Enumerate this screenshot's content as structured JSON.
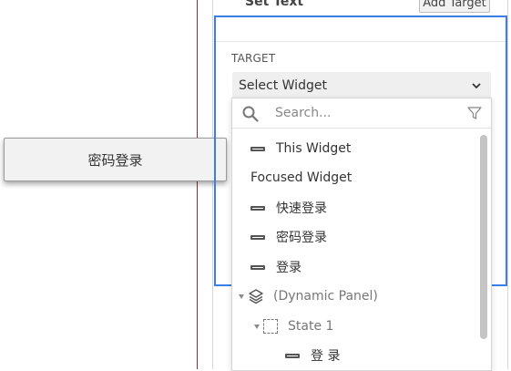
{
  "canvas": {
    "button_label": "密码登录"
  },
  "panel": {
    "set_text_label": "Set Text",
    "add_target_label": "Add Target",
    "target_label": "TARGET",
    "target_select_value": "Select Widget"
  },
  "dropdown": {
    "search_placeholder": "Search...",
    "items": [
      {
        "label": "This Widget",
        "icon": "widget-rect-icon"
      },
      {
        "label": "Focused Widget",
        "icon": ""
      },
      {
        "label": "快速登录",
        "icon": "widget-rect-icon"
      },
      {
        "label": "密码登录",
        "icon": "widget-rect-icon"
      },
      {
        "label": "登录",
        "icon": "widget-rect-icon"
      },
      {
        "label": "(Dynamic Panel)",
        "icon": "layers-icon"
      },
      {
        "label": "State 1",
        "icon": "state-icon"
      },
      {
        "label": "登 录",
        "icon": "widget-rect-icon"
      }
    ]
  },
  "colors": {
    "selection_border": "#3a7ee8",
    "canvas_separator": "#8a2a3a"
  }
}
